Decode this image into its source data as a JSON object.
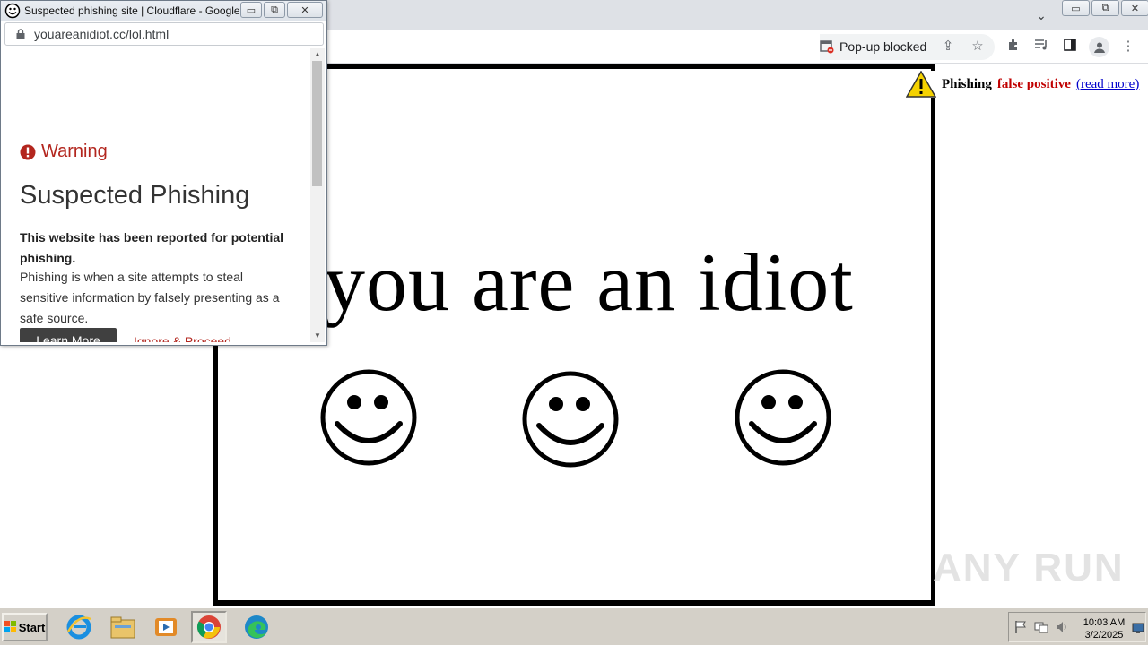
{
  "popup": {
    "title": "Suspected phishing site | Cloudflare - Google C...",
    "url": "youareanidiot.cc/lol.html",
    "warning_label": "Warning",
    "heading": "Suspected Phishing",
    "reported_text": "This website has been reported for potential phishing.",
    "description": "Phishing is when a site attempts to steal sensitive information by falsely presenting as a safe source.",
    "learn_more": "Learn More",
    "ignore_proceed": "Ignore & Proceed"
  },
  "toolbar": {
    "popup_blocked": "Pop-up blocked"
  },
  "page": {
    "main_text": "you are an idiot",
    "phishing_note": {
      "word1": "Phishing",
      "word2": "false positive",
      "link": "(read more)"
    }
  },
  "watermark": "ANY RUN",
  "taskbar": {
    "start_label": "Start",
    "time": "10:03 AM",
    "date": "3/2/2025"
  },
  "colors": {
    "warning_red": "#b3261e",
    "chrome_frame": "#dee1e6",
    "taskbar": "#d4d0c8"
  }
}
